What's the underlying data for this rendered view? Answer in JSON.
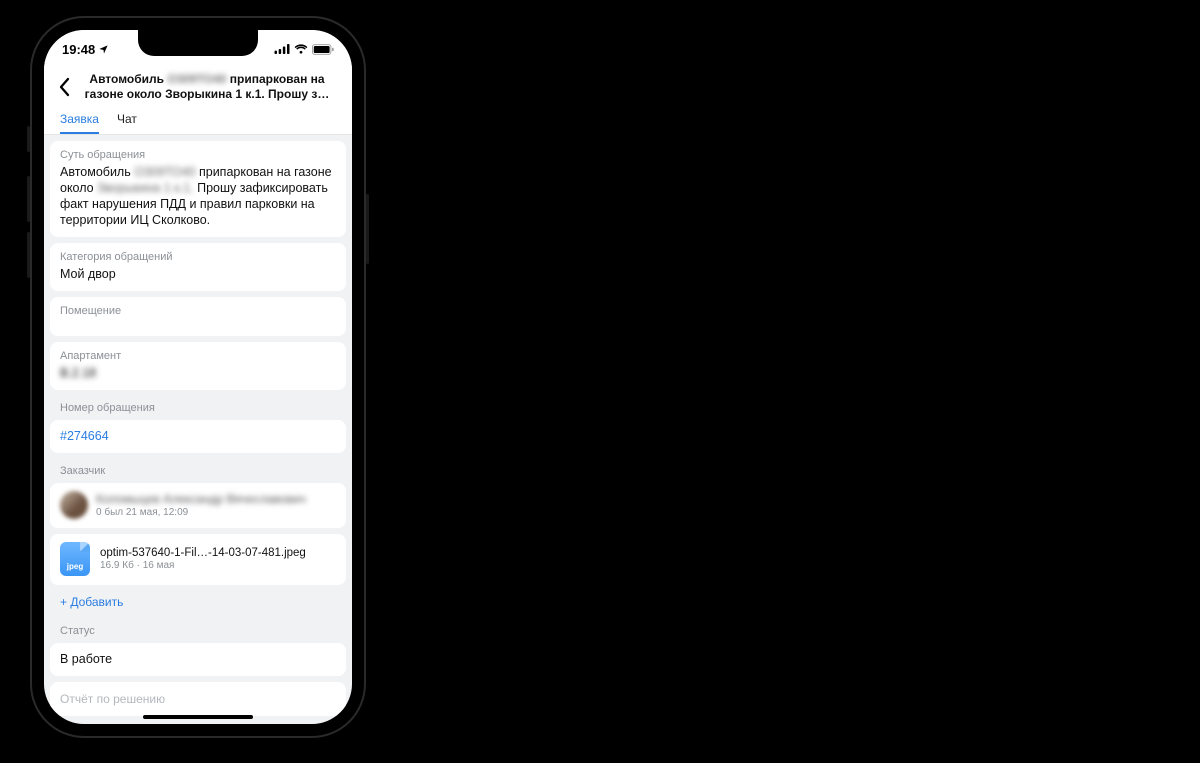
{
  "statusbar": {
    "time": "19:48"
  },
  "header": {
    "title_prefix": "Автомобиль ",
    "title_redacted": "О309ТО40",
    "title_line1_suffix": " припаркован на",
    "title_line2": "газоне около Зворыкина 1 к.1. Прошу з…"
  },
  "tabs": {
    "request": "Заявка",
    "chat": "Чат"
  },
  "subject": {
    "label": "Суть обращения",
    "t1": "Автомобиль ",
    "redacted1": "О309ТО40",
    "t2": " припаркован на газоне около ",
    "redacted2": "Зворыкина 1 к.1.",
    "t3": " Прошу зафиксировать факт нарушения ПДД и правил парковки на территории ИЦ Сколково."
  },
  "category": {
    "label": "Категория обращений",
    "value": "Мой двор"
  },
  "room": {
    "label": "Помещение"
  },
  "apartment": {
    "label": "Апартамент",
    "value_redacted": "В.2.18"
  },
  "number": {
    "label": "Номер обращения",
    "value": "#274664"
  },
  "customer": {
    "label": "Заказчик",
    "name_redacted": "Коломыцев Александр Вячеславович",
    "seen": "0 был 21 мая, 12:09"
  },
  "file": {
    "icon_label": "jpeg",
    "name": "optim-537640-1-Fil…-14-03-07-481.jpeg",
    "size": "16.9 Кб",
    "sep": " · ",
    "date": "16 мая"
  },
  "add": {
    "label": "+ Добавить"
  },
  "status": {
    "label": "Статус",
    "value": "В работе"
  },
  "resolution": {
    "placeholder": "Отчёт по решению"
  }
}
